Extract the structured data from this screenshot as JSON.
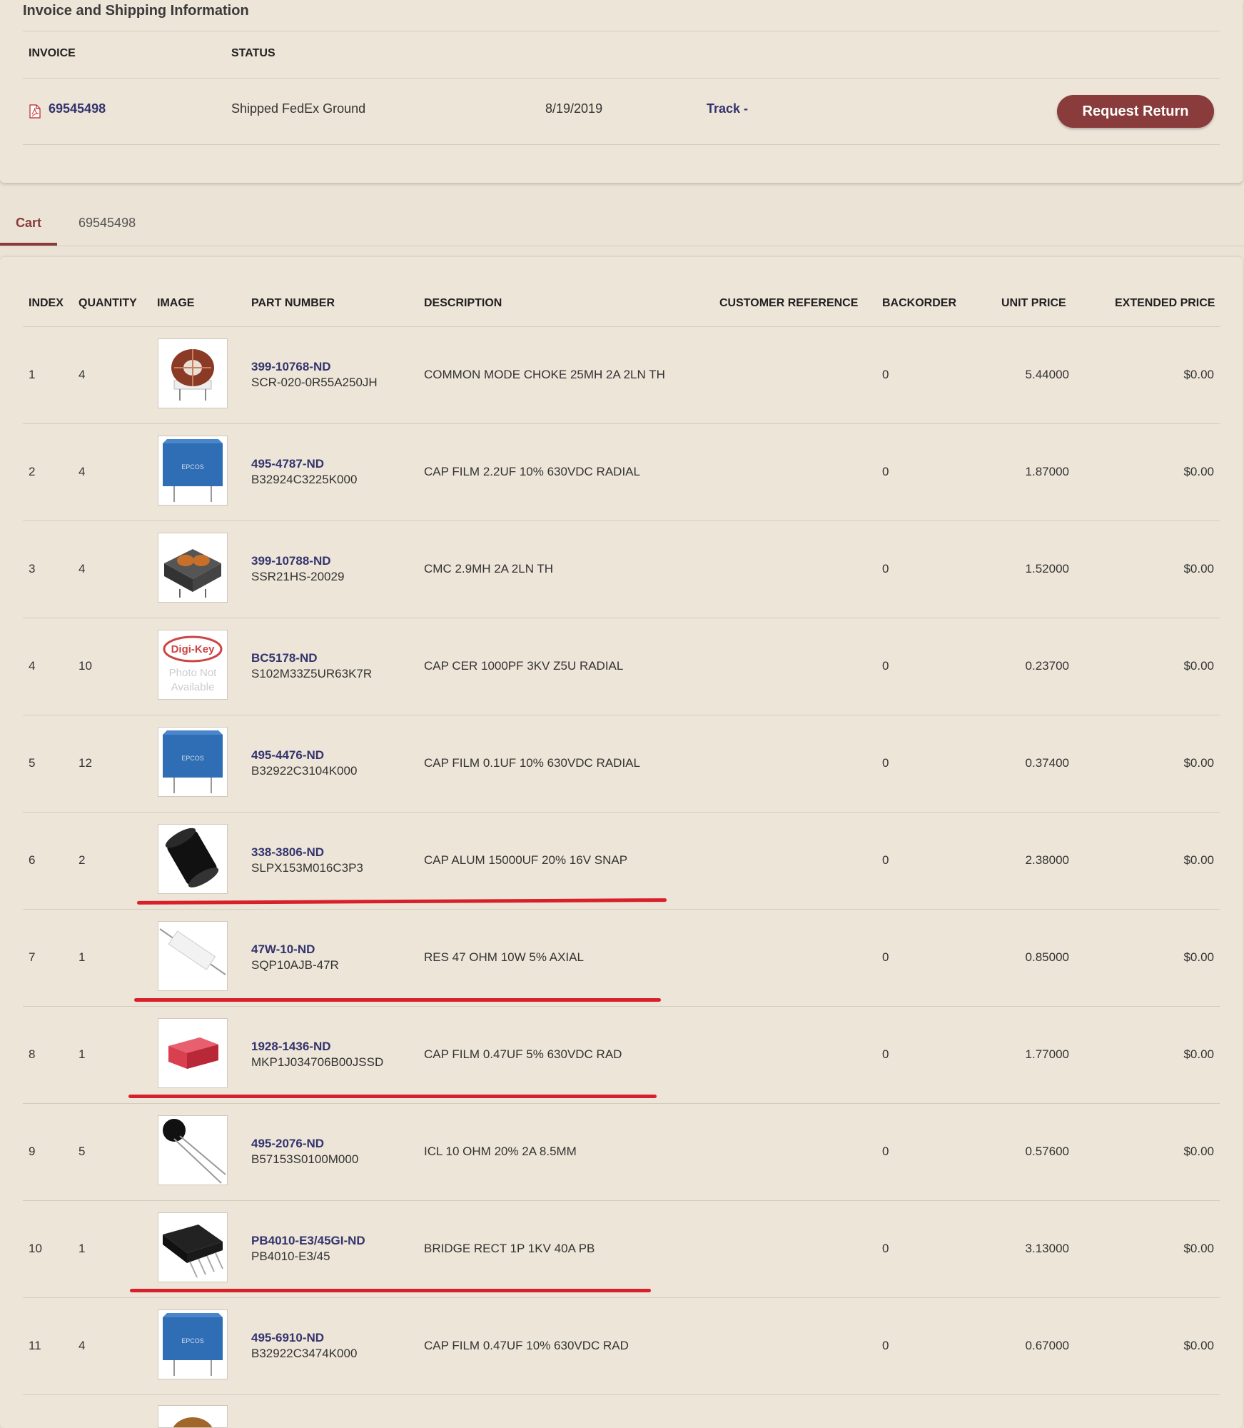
{
  "invoice_section": {
    "title": "Invoice and Shipping Information",
    "col_invoice": "INVOICE",
    "col_status": "STATUS",
    "invoice_number": "69545498",
    "status": "Shipped FedEx Ground",
    "date": "8/19/2019",
    "track_label": "Track -",
    "request_return_label": "Request Return"
  },
  "tabs": [
    {
      "label": "Cart",
      "active": true
    },
    {
      "label": "69545498",
      "active": false
    }
  ],
  "table": {
    "headers": {
      "index": "INDEX",
      "quantity": "QUANTITY",
      "image": "IMAGE",
      "part_number": "PART NUMBER",
      "description": "DESCRIPTION",
      "customer_reference": "CUSTOMER REFERENCE",
      "backorder": "BACKORDER",
      "unit_price": "UNIT PRICE",
      "extended_price": "EXTENDED PRICE"
    },
    "rows": [
      {
        "index": "1",
        "quantity": "4",
        "part_link": "399-10768-ND",
        "mfr_part": "SCR-020-0R55A250JH",
        "description": "COMMON MODE CHOKE 25MH 2A 2LN TH",
        "backorder": "0",
        "unit_price": "5.44000",
        "extended_price": "$0.00",
        "image": "toroid-choke-icon"
      },
      {
        "index": "2",
        "quantity": "4",
        "part_link": "495-4787-ND",
        "mfr_part": "B32924C3225K000",
        "description": "CAP FILM 2.2UF 10% 630VDC RADIAL",
        "backorder": "0",
        "unit_price": "1.87000",
        "extended_price": "$0.00",
        "image": "film-capacitor-icon"
      },
      {
        "index": "3",
        "quantity": "4",
        "part_link": "399-10788-ND",
        "mfr_part": "SSR21HS-20029",
        "description": "CMC 2.9MH 2A 2LN TH",
        "backorder": "0",
        "unit_price": "1.52000",
        "extended_price": "$0.00",
        "image": "choke-module-icon"
      },
      {
        "index": "4",
        "quantity": "10",
        "part_link": "BC5178-ND",
        "mfr_part": "S102M33Z5UR63K7R",
        "description": "CAP CER 1000PF 3KV Z5U RADIAL",
        "backorder": "0",
        "unit_price": "0.23700",
        "extended_price": "$0.00",
        "image": "photo-not-available-icon"
      },
      {
        "index": "5",
        "quantity": "12",
        "part_link": "495-4476-ND",
        "mfr_part": "B32922C3104K000",
        "description": "CAP FILM 0.1UF 10% 630VDC RADIAL",
        "backorder": "0",
        "unit_price": "0.37400",
        "extended_price": "$0.00",
        "image": "film-capacitor-icon"
      },
      {
        "index": "6",
        "quantity": "2",
        "part_link": "338-3806-ND",
        "mfr_part": "SLPX153M016C3P3",
        "description": "CAP ALUM 15000UF 20% 16V SNAP",
        "backorder": "0",
        "unit_price": "2.38000",
        "extended_price": "$0.00",
        "image": "electrolytic-capacitor-icon"
      },
      {
        "index": "7",
        "quantity": "1",
        "part_link": "47W-10-ND",
        "mfr_part": "SQP10AJB-47R",
        "description": "RES 47 OHM 10W 5% AXIAL",
        "backorder": "0",
        "unit_price": "0.85000",
        "extended_price": "$0.00",
        "image": "power-resistor-icon"
      },
      {
        "index": "8",
        "quantity": "1",
        "part_link": "1928-1436-ND",
        "mfr_part": "MKP1J034706B00JSSD",
        "description": "CAP FILM 0.47UF 5% 630VDC RAD",
        "backorder": "0",
        "unit_price": "1.77000",
        "extended_price": "$0.00",
        "image": "red-film-capacitor-icon"
      },
      {
        "index": "9",
        "quantity": "5",
        "part_link": "495-2076-ND",
        "mfr_part": "B57153S0100M000",
        "description": "ICL 10 OHM 20% 2A 8.5MM",
        "backorder": "0",
        "unit_price": "0.57600",
        "extended_price": "$0.00",
        "image": "thermistor-icon"
      },
      {
        "index": "10",
        "quantity": "1",
        "part_link": "PB4010-E3/45GI-ND",
        "mfr_part": "PB4010-E3/45",
        "description": "BRIDGE RECT 1P 1KV 40A PB",
        "backorder": "0",
        "unit_price": "3.13000",
        "extended_price": "$0.00",
        "image": "bridge-rectifier-icon"
      },
      {
        "index": "11",
        "quantity": "4",
        "part_link": "495-6910-ND",
        "mfr_part": "B32922C3474K000",
        "description": "CAP FILM 0.47UF 10% 630VDC RAD",
        "backorder": "0",
        "unit_price": "0.67000",
        "extended_price": "$0.00",
        "image": "film-capacitor-icon"
      }
    ]
  },
  "colors": {
    "background": "#ebe3d6",
    "accent": "#8a3b3b",
    "link": "#34346e",
    "annotation": "#d8202a"
  },
  "placeholder_pdf": {
    "photo_na_brand": "Digi-Key",
    "photo_na_line1": "Photo Not",
    "photo_na_line2": "Available"
  }
}
